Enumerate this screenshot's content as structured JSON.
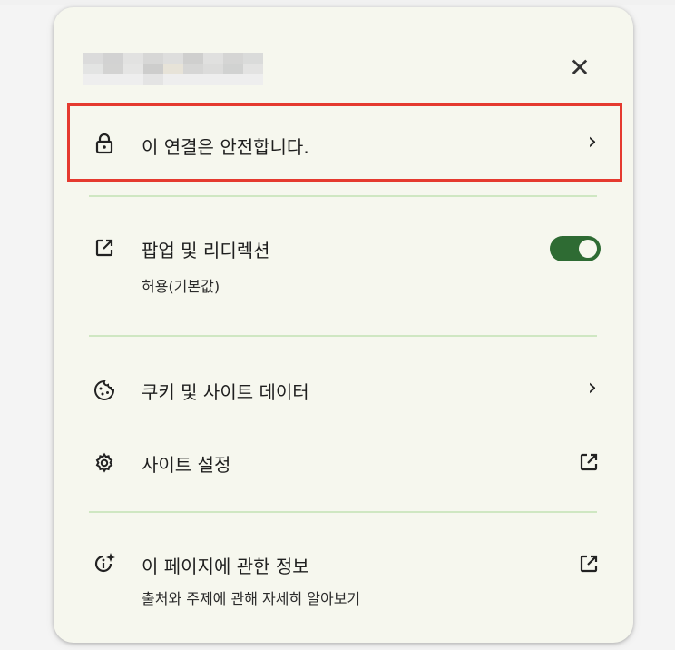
{
  "popup": {
    "close_label": "✕",
    "connection": {
      "label": "이 연결은 안전합니다.",
      "chevron": "›",
      "icon": "lock-icon"
    },
    "popups": {
      "label": "팝업 및 리디렉션",
      "sublabel": "허용(기본값)",
      "icon": "open-external-icon",
      "toggle_on": true
    },
    "cookies": {
      "label": "쿠키 및 사이트 데이터",
      "chevron": "›",
      "icon": "cookie-icon"
    },
    "site_settings": {
      "label": "사이트 설정",
      "icon": "gear-icon",
      "trailing_icon": "open-external-icon"
    },
    "about": {
      "label": "이 페이지에 관한 정보",
      "sublabel": "출처와 주제에 관해 자세히 알아보기",
      "icon": "info-sparkle-icon",
      "trailing_icon": "open-external-icon"
    }
  },
  "colors": {
    "panel_bg": "#f6f7ee",
    "divider": "#cfe7c2",
    "toggle_on": "#2e6b33",
    "highlight": "#e53a2f"
  }
}
